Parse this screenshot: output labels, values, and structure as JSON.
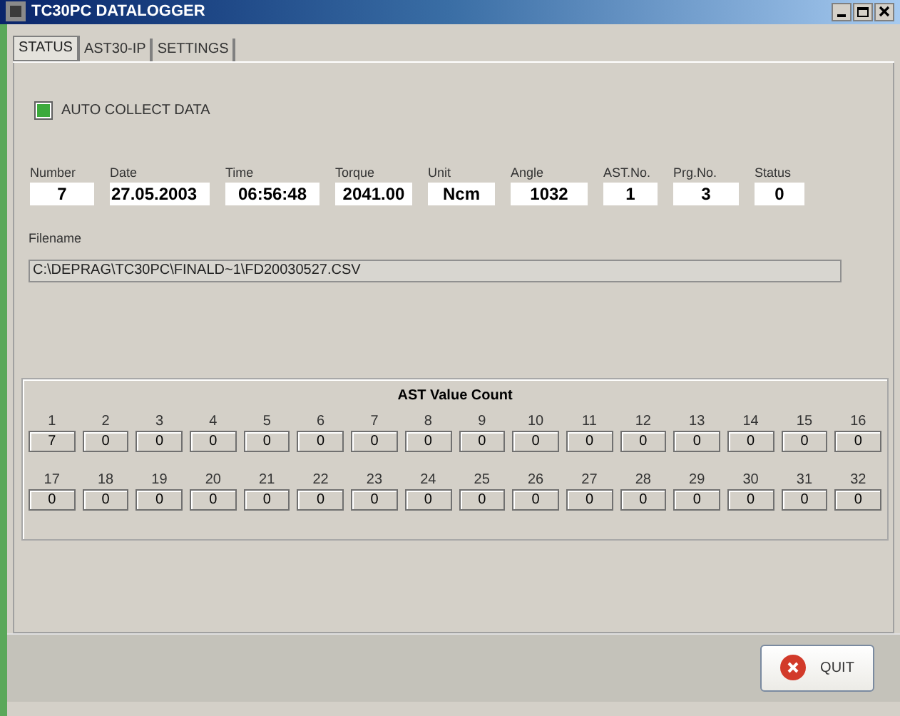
{
  "window": {
    "title": "TC30PC DATALOGGER"
  },
  "tabs": [
    {
      "label": "STATUS",
      "selected": true
    },
    {
      "label": "AST30-IP",
      "selected": false
    },
    {
      "label": "SETTINGS",
      "selected": false
    }
  ],
  "auto_collect": {
    "label": "AUTO COLLECT DATA",
    "checked": true
  },
  "fields": [
    {
      "label": "Number",
      "value": "7"
    },
    {
      "label": "Date",
      "value": "27.05.2003"
    },
    {
      "label": "Time",
      "value": "06:56:48"
    },
    {
      "label": "Torque",
      "value": "2041.00"
    },
    {
      "label": "Unit",
      "value": "Ncm"
    },
    {
      "label": "Angle",
      "value": "1032"
    },
    {
      "label": "AST.No.",
      "value": "1"
    },
    {
      "label": "Prg.No.",
      "value": "3"
    },
    {
      "label": "Status",
      "value": "0"
    }
  ],
  "filename": {
    "label": "Filename",
    "value": "C:\\DEPRAG\\TC30PC\\FINALD~1\\FD20030527.CSV"
  },
  "ast_value_count": {
    "title": "AST Value Count",
    "counts": [
      {
        "label": "1",
        "value": "7"
      },
      {
        "label": "2",
        "value": "0"
      },
      {
        "label": "3",
        "value": "0"
      },
      {
        "label": "4",
        "value": "0"
      },
      {
        "label": "5",
        "value": "0"
      },
      {
        "label": "6",
        "value": "0"
      },
      {
        "label": "7",
        "value": "0"
      },
      {
        "label": "8",
        "value": "0"
      },
      {
        "label": "9",
        "value": "0"
      },
      {
        "label": "10",
        "value": "0"
      },
      {
        "label": "11",
        "value": "0"
      },
      {
        "label": "12",
        "value": "0"
      },
      {
        "label": "13",
        "value": "0"
      },
      {
        "label": "14",
        "value": "0"
      },
      {
        "label": "15",
        "value": "0"
      },
      {
        "label": "16",
        "value": "0"
      },
      {
        "label": "17",
        "value": "0"
      },
      {
        "label": "18",
        "value": "0"
      },
      {
        "label": "19",
        "value": "0"
      },
      {
        "label": "20",
        "value": "0"
      },
      {
        "label": "21",
        "value": "0"
      },
      {
        "label": "22",
        "value": "0"
      },
      {
        "label": "23",
        "value": "0"
      },
      {
        "label": "24",
        "value": "0"
      },
      {
        "label": "25",
        "value": "0"
      },
      {
        "label": "26",
        "value": "0"
      },
      {
        "label": "27",
        "value": "0"
      },
      {
        "label": "28",
        "value": "0"
      },
      {
        "label": "29",
        "value": "0"
      },
      {
        "label": "30",
        "value": "0"
      },
      {
        "label": "31",
        "value": "0"
      },
      {
        "label": "32",
        "value": "0"
      }
    ]
  },
  "buttons": [
    {
      "label": "QUIT"
    }
  ]
}
